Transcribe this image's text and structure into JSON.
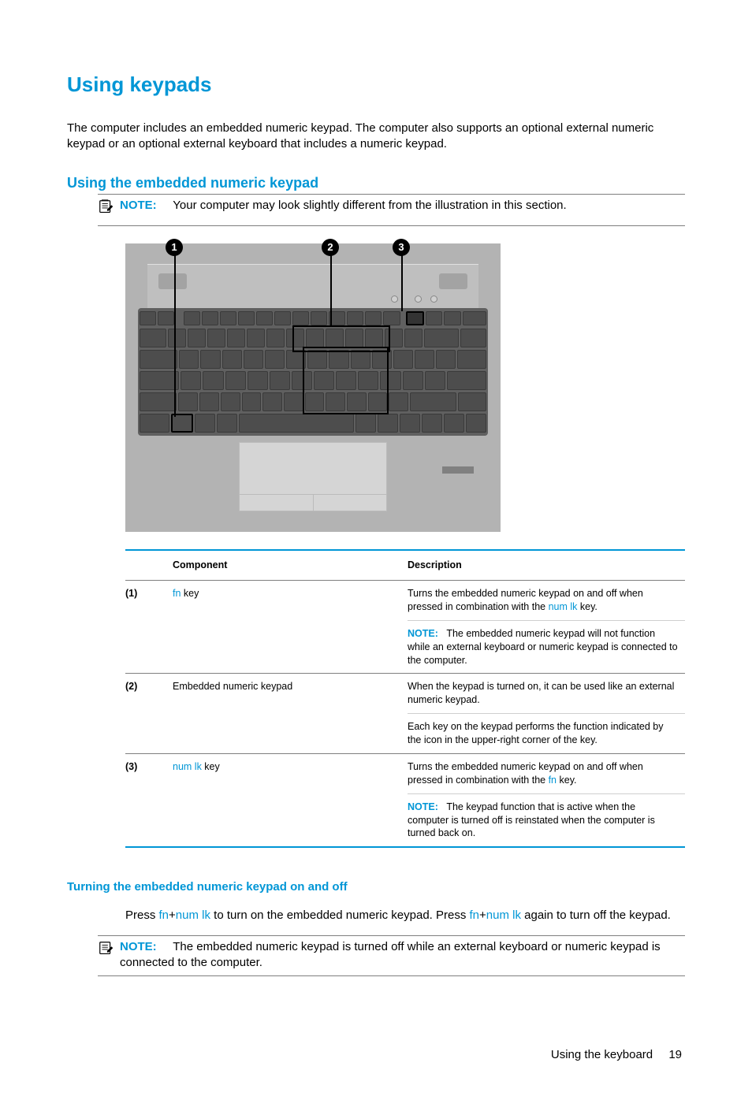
{
  "headings": {
    "h1": "Using keypads",
    "h2": "Using the embedded numeric keypad",
    "h3": "Turning the embedded numeric keypad on and off"
  },
  "intro": "The computer includes an embedded numeric keypad. The computer also supports an optional external numeric keypad or an optional external keyboard that includes a numeric keypad.",
  "note1": {
    "label": "NOTE:",
    "text": "Your computer may look slightly different from the illustration in this section."
  },
  "callouts": {
    "c1": "1",
    "c2": "2",
    "c3": "3"
  },
  "table": {
    "headers": {
      "component": "Component",
      "description": "Description"
    },
    "rows": {
      "r1": {
        "num": "(1)",
        "comp_link": "fn",
        "comp_rest": " key",
        "desc1a": "Turns the embedded numeric keypad on and off when pressed in combination with the ",
        "desc1b_link": "num lk",
        "desc1c": " key.",
        "note_label": "NOTE:",
        "note_text": "The embedded numeric keypad will not function while an external keyboard or numeric keypad is connected to the computer."
      },
      "r2": {
        "num": "(2)",
        "comp": "Embedded numeric keypad",
        "desc1": "When the keypad is turned on, it can be used like an external numeric keypad.",
        "desc2": "Each key on the keypad performs the function indicated by the icon in the upper-right corner of the key."
      },
      "r3": {
        "num": "(3)",
        "comp_link": "num lk",
        "comp_rest": " key",
        "desc1a": "Turns the embedded numeric keypad on and off when pressed in combination with the ",
        "desc1b_link": "fn",
        "desc1c": " key.",
        "note_label": "NOTE:",
        "note_text": "The keypad function that is active when the computer is turned off is reinstated when the computer is turned back on."
      }
    }
  },
  "turning": {
    "p1a": "Press ",
    "fn": "fn",
    "plus": "+",
    "numlk": "num lk",
    "p1b": " to turn on the embedded numeric keypad. Press ",
    "p1c": " again to turn off the keypad."
  },
  "note2": {
    "label": "NOTE:",
    "text": "The embedded numeric keypad is turned off while an external keyboard or numeric keypad is connected to the computer."
  },
  "footer": {
    "section": "Using the keyboard",
    "page": "19"
  }
}
